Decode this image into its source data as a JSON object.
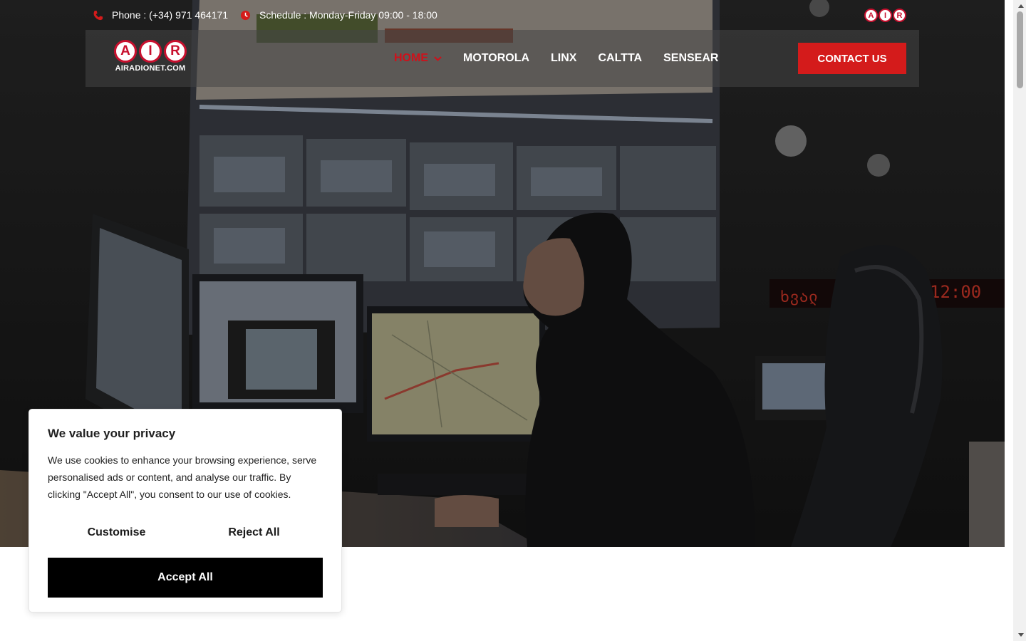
{
  "topbar": {
    "phone_text": "Phone : (+34) 971 464171",
    "schedule_text": "Schedule : Monday-Friday 09:00 - 18:00",
    "mini_logo_letters": [
      "A",
      "I",
      "R"
    ],
    "icons": {
      "phone": "phone-icon",
      "schedule": "clock-icon"
    }
  },
  "navbar": {
    "logo_letters": [
      "A",
      "I",
      "R"
    ],
    "logo_domain": "AIRADIONET.COM",
    "menu": [
      {
        "label": "HOME",
        "active": true,
        "has_dropdown": true
      },
      {
        "label": "MOTOROLA",
        "active": false
      },
      {
        "label": "LINX",
        "active": false
      },
      {
        "label": "CALTTA",
        "active": false
      },
      {
        "label": "SENSEAR",
        "active": false
      }
    ],
    "contact_button": "CONTACT US"
  },
  "hero": {
    "wall_clock_text": "12:00",
    "ticker_text": "ხვალ"
  },
  "cookie_banner": {
    "title": "We value your privacy",
    "body": "We use cookies to enhance your browsing experience, serve personalised ads or content, and analyse our traffic. By clicking \"Accept All\", you consent to our use of cookies.",
    "customise_label": "Customise",
    "reject_label": "Reject All",
    "accept_label": "Accept All"
  },
  "colors": {
    "brand_red": "#d41b1b",
    "nav_active": "#d0101a",
    "accept_button": "#000000"
  }
}
